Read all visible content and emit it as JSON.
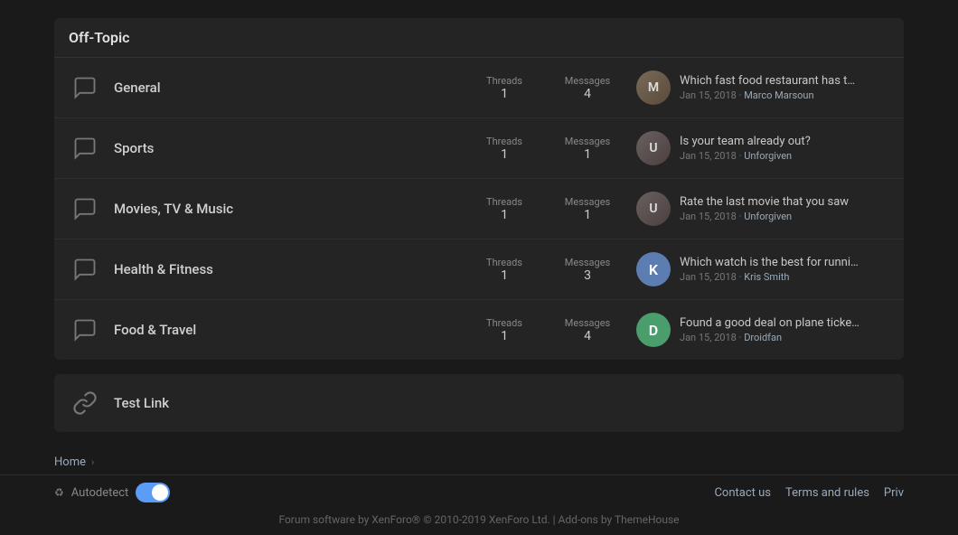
{
  "colors": {
    "bg": "#1a1a1a",
    "section_bg": "#242424",
    "accent": "#5b9cf6",
    "toggle_color": "#5b7db1"
  },
  "section": {
    "title": "Off-Topic"
  },
  "forums": [
    {
      "id": "general",
      "name": "General",
      "threads": "1",
      "messages": "4",
      "post_title": "Which fast food restaurant has the ...",
      "post_date": "Jan 15, 2018",
      "post_author": "Marco Marsoun",
      "avatar_type": "photo",
      "avatar_label": "M",
      "avatar_class": "avatar-marco"
    },
    {
      "id": "sports",
      "name": "Sports",
      "threads": "1",
      "messages": "1",
      "post_title": "Is your team already out?",
      "post_date": "Jan 15, 2018",
      "post_author": "Unforgiven",
      "avatar_type": "photo",
      "avatar_label": "U",
      "avatar_class": "avatar-unforgiven"
    },
    {
      "id": "movies",
      "name": "Movies, TV & Music",
      "threads": "1",
      "messages": "1",
      "post_title": "Rate the last movie that you saw",
      "post_date": "Jan 15, 2018",
      "post_author": "Unforgiven",
      "avatar_type": "photo",
      "avatar_label": "U",
      "avatar_class": "avatar-unforgiven"
    },
    {
      "id": "health",
      "name": "Health & Fitness",
      "threads": "1",
      "messages": "3",
      "post_title": "Which watch is the best for running?",
      "post_date": "Jan 15, 2018",
      "post_author": "Kris Smith",
      "avatar_type": "letter",
      "avatar_letter": "K",
      "avatar_class": "avatar-k"
    },
    {
      "id": "food",
      "name": "Food & Travel",
      "threads": "1",
      "messages": "4",
      "post_title": "Found a good deal on plane tickets...",
      "post_date": "Jan 15, 2018",
      "post_author": "Droidfan",
      "avatar_type": "letter",
      "avatar_letter": "D",
      "avatar_class": "avatar-d"
    }
  ],
  "test_link": {
    "name": "Test Link"
  },
  "labels": {
    "threads": "Threads",
    "messages": "Messages"
  },
  "breadcrumb": {
    "home": "Home"
  },
  "footer": {
    "autodetect": "Autodetect",
    "contact_us": "Contact us",
    "terms": "Terms and rules",
    "privacy": "Priv",
    "copyright": "Forum software by XenForo® © 2010-2019 XenForo Ltd. | Add-ons by ThemeHouse"
  }
}
